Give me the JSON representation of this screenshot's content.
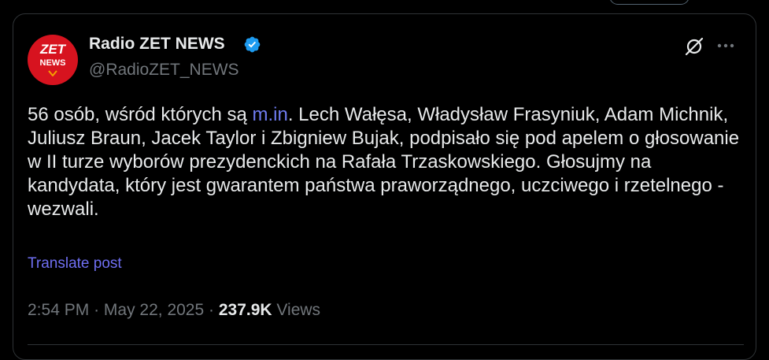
{
  "author": {
    "display_name": "Radio ZET NEWS",
    "handle": "@RadioZET_NEWS",
    "avatar_logo_top": "ZET",
    "avatar_logo_bottom": "NEWS",
    "verified": true
  },
  "tweet": {
    "text_before_link": "56 osób, wśród których są ",
    "link_text": "m.in",
    "text_after_link": ". Lech Wałęsa, Władysław Frasyniuk, Adam Michnik, Juliusz Braun, Jacek Taylor i Zbigniew Bujak, podpisało się pod apelem o głosowanie w II turze wyborów prezydenckich na Rafała Trzaskowskiego. Głosujmy na kandydata, który jest gwarantem państwa praworządnego, uczciwego i rzetelnego - wezwali.",
    "translate_label": "Translate post"
  },
  "meta": {
    "time": "2:54 PM",
    "separator": "·",
    "date": "May 22, 2025",
    "views_count": "237.9K",
    "views_label": "Views"
  },
  "icons": {
    "verified": "verified-badge-icon",
    "grok": "grok-icon",
    "more": "more-options-icon"
  },
  "colors": {
    "background": "#000000",
    "text_primary": "#e7e9ea",
    "text_secondary": "#71767b",
    "link": "#6f7cf0",
    "verified": "#1d9bf0",
    "brand_red": "#d7131f",
    "border": "#2f3336"
  }
}
